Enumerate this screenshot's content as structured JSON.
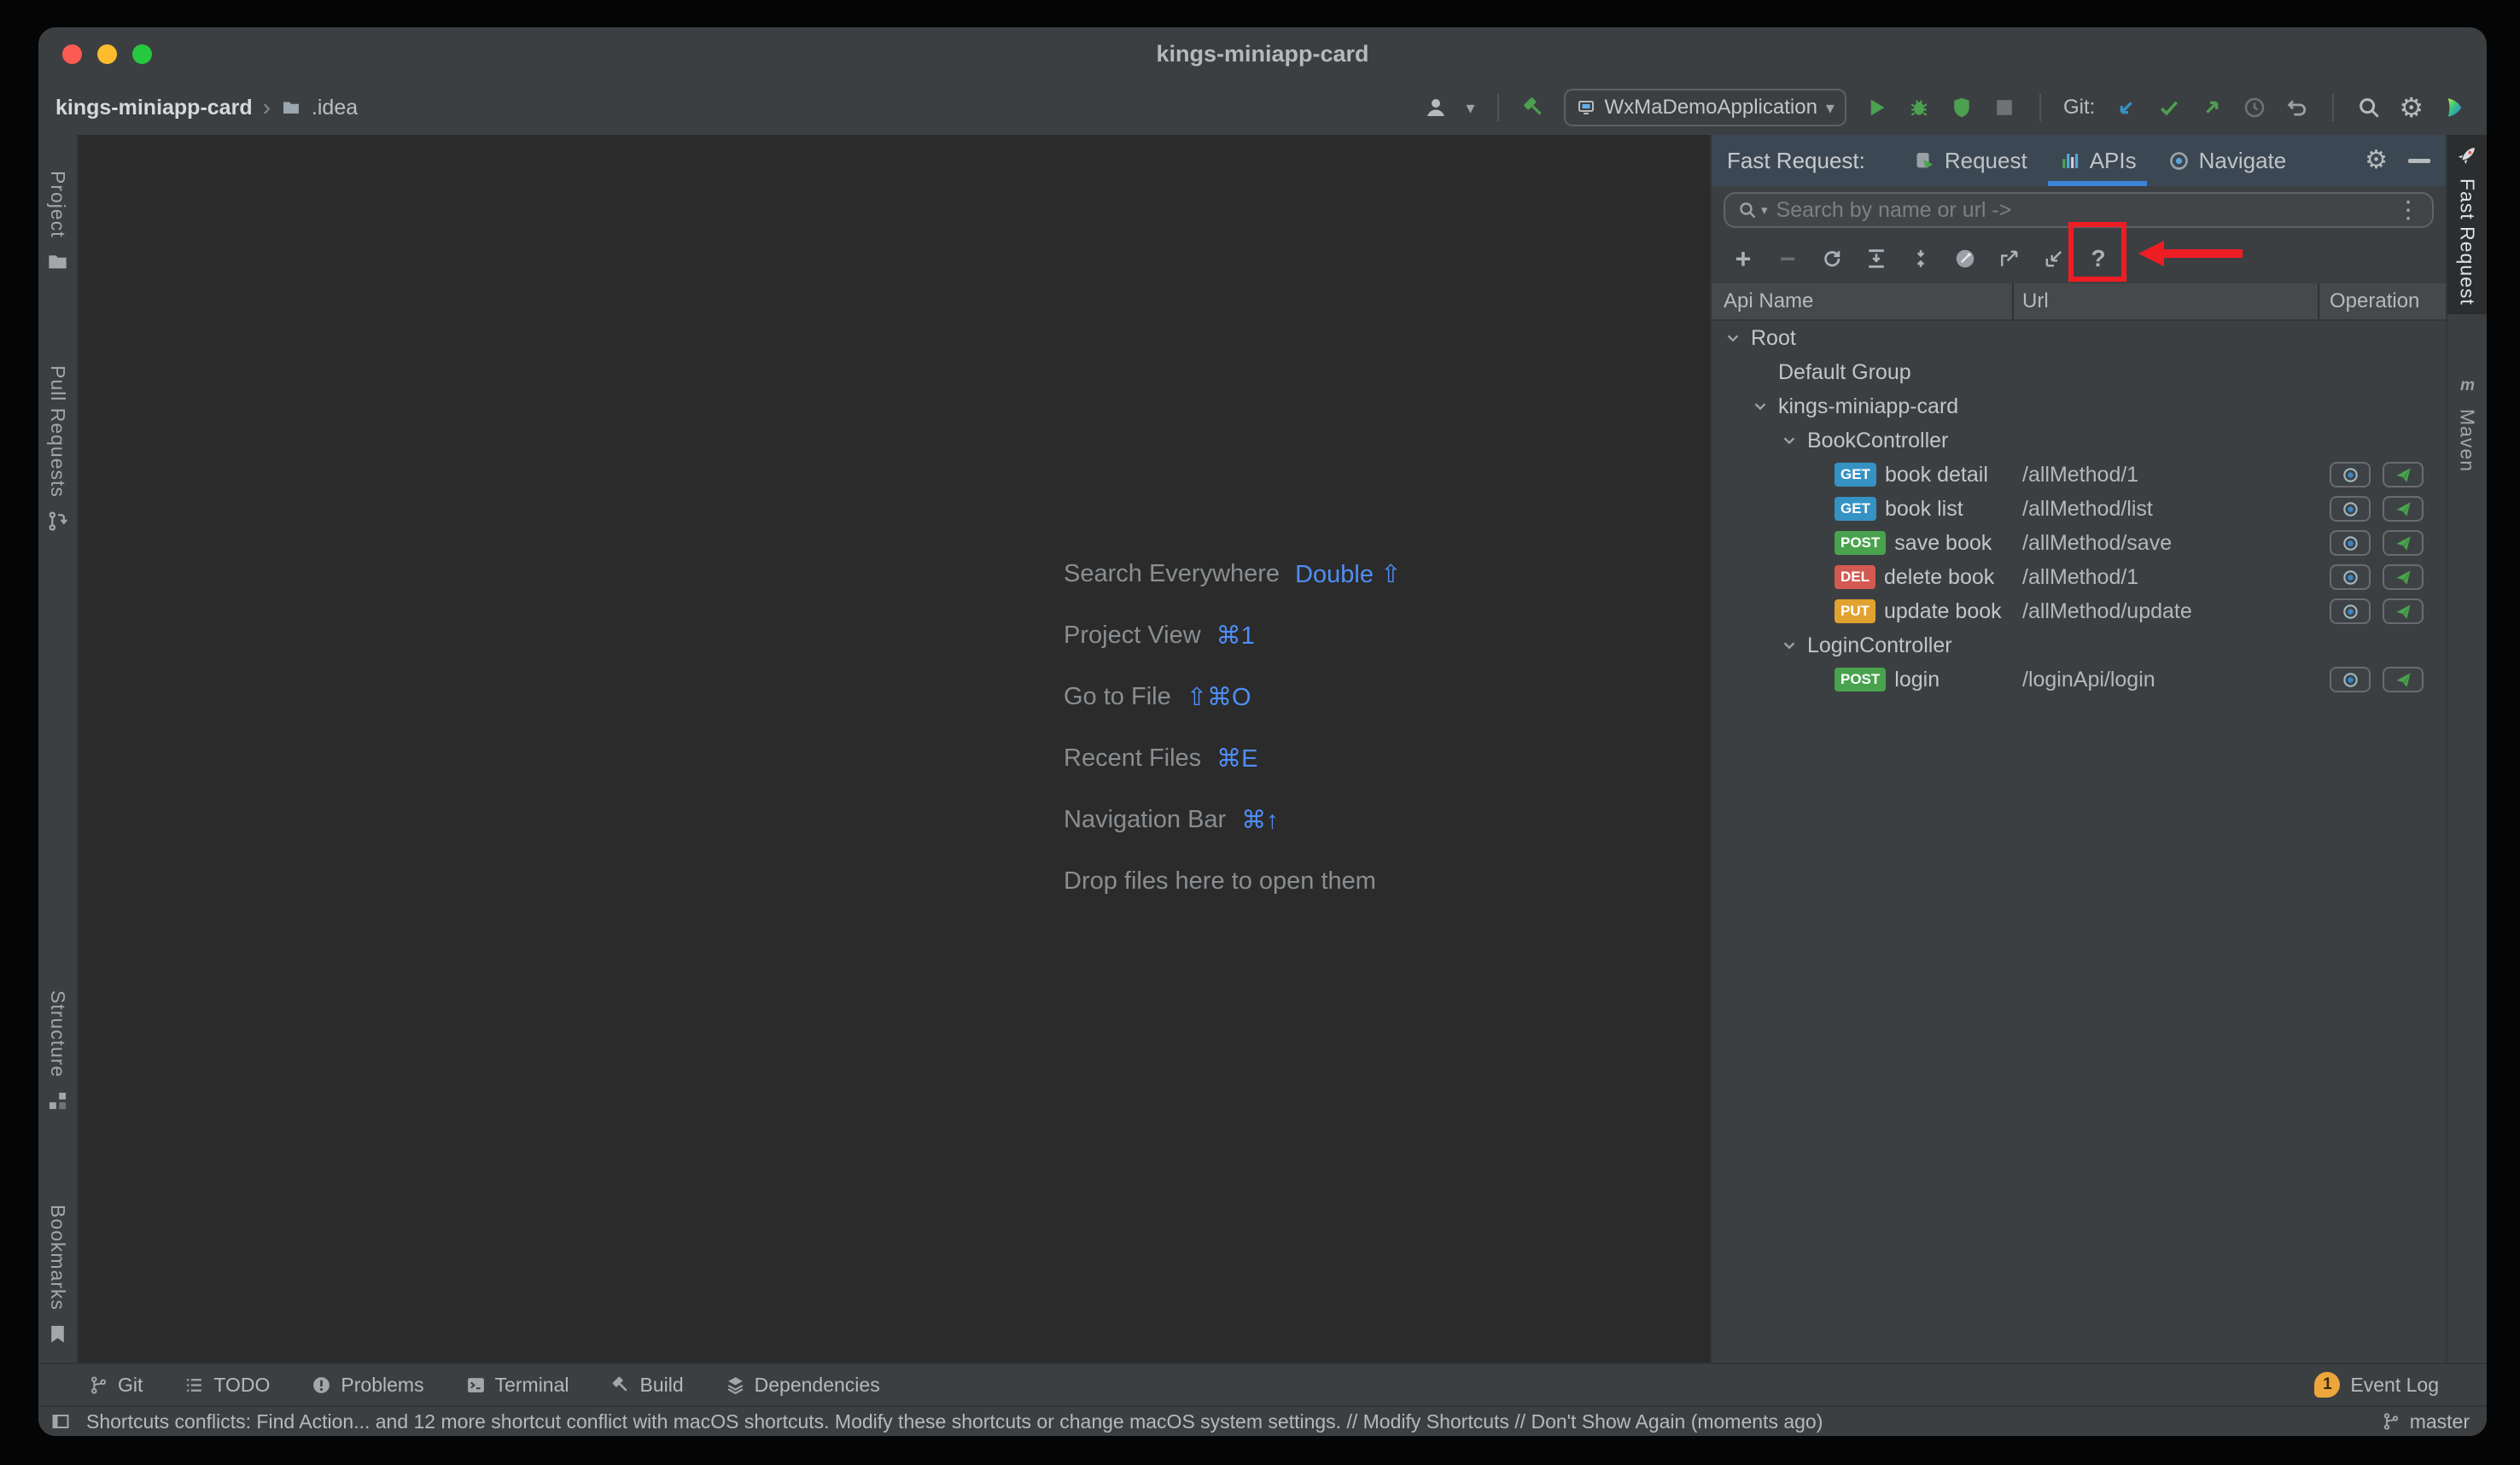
{
  "window": {
    "title": "kings-miniapp-card"
  },
  "breadcrumb": {
    "project": "kings-miniapp-card",
    "separator": "›",
    "folder": ".idea"
  },
  "main_toolbar": {
    "run_config": "WxMaDemoApplication",
    "git_label": "Git:"
  },
  "left_stripe": {
    "top": [
      {
        "label": "Project",
        "icon": "folder-icon"
      },
      {
        "label": "Pull Requests",
        "icon": "pull-request-icon"
      }
    ],
    "bottom": [
      {
        "label": "Structure",
        "icon": "structure-icon"
      },
      {
        "label": "Bookmarks",
        "icon": "bookmark-icon"
      }
    ]
  },
  "right_stripe": [
    {
      "label": "Fast Request",
      "icon": "rocket-icon",
      "active": true
    },
    {
      "label": "Maven",
      "icon": "maven-icon",
      "active": false
    }
  ],
  "editor": {
    "shortcuts": [
      {
        "label": "Search Everywhere",
        "keys": "Double ⇧"
      },
      {
        "label": "Project View",
        "keys": "⌘1"
      },
      {
        "label": "Go to File",
        "keys": "⇧⌘O"
      },
      {
        "label": "Recent Files",
        "keys": "⌘E"
      },
      {
        "label": "Navigation Bar",
        "keys": "⌘↑"
      },
      {
        "label": "Drop files here to open them",
        "keys": ""
      }
    ]
  },
  "fast_request": {
    "title": "Fast Request:",
    "tabs": [
      {
        "label": "Request",
        "icon": "request-tab-icon",
        "selected": false
      },
      {
        "label": "APIs",
        "icon": "apis-tab-icon",
        "selected": true
      },
      {
        "label": "Navigate",
        "icon": "navigate-tab-icon",
        "selected": false
      }
    ],
    "search": {
      "placeholder": "Search by name or url ->"
    },
    "toolbar": [
      {
        "icon": "add-icon",
        "disabled": false,
        "annotated": false
      },
      {
        "icon": "remove-icon",
        "disabled": true,
        "annotated": false
      },
      {
        "icon": "refresh-icon",
        "disabled": false,
        "annotated": false
      },
      {
        "icon": "expand-all-icon",
        "disabled": false,
        "annotated": false
      },
      {
        "icon": "collapse-all-icon",
        "disabled": false,
        "annotated": false
      },
      {
        "icon": "postman-icon",
        "disabled": false,
        "annotated": false
      },
      {
        "icon": "export-icon",
        "disabled": false,
        "annotated": false
      },
      {
        "icon": "import-icon",
        "disabled": false,
        "annotated": false
      },
      {
        "icon": "help-icon",
        "disabled": false,
        "annotated": true
      }
    ],
    "columns": [
      "Api Name",
      "Url",
      "Operation"
    ],
    "tree": [
      {
        "level": 0,
        "type": "group",
        "chevron": true,
        "name": "Root",
        "url": ""
      },
      {
        "level": 1,
        "type": "group",
        "chevron": false,
        "name": "Default Group",
        "url": ""
      },
      {
        "level": 1,
        "type": "group",
        "chevron": true,
        "name": "kings-miniapp-card",
        "url": ""
      },
      {
        "level": 2,
        "type": "group",
        "chevron": true,
        "name": "BookController",
        "url": ""
      },
      {
        "level": 3,
        "type": "api",
        "method": "GET",
        "name": "book detail",
        "url": "/allMethod/1"
      },
      {
        "level": 3,
        "type": "api",
        "method": "GET",
        "name": "book list",
        "url": "/allMethod/list"
      },
      {
        "level": 3,
        "type": "api",
        "method": "POST",
        "name": "save book",
        "url": "/allMethod/save"
      },
      {
        "level": 3,
        "type": "api",
        "method": "DEL",
        "name": "delete book",
        "url": "/allMethod/1"
      },
      {
        "level": 3,
        "type": "api",
        "method": "PUT",
        "name": "update book",
        "url": "/allMethod/update"
      },
      {
        "level": 2,
        "type": "group",
        "chevron": true,
        "name": "LoginController",
        "url": ""
      },
      {
        "level": 3,
        "type": "api",
        "method": "POST",
        "name": "login",
        "url": "/loginApi/login"
      }
    ],
    "method_colors": {
      "GET": "#3592c4",
      "POST": "#49a24d",
      "DEL": "#d35a52",
      "PUT": "#e2a230"
    }
  },
  "bottom_toolbar": {
    "items": [
      {
        "label": "Git",
        "icon": "git-branch-icon"
      },
      {
        "label": "TODO",
        "icon": "todo-list-icon"
      },
      {
        "label": "Problems",
        "icon": "problems-icon"
      },
      {
        "label": "Terminal",
        "icon": "terminal-icon"
      },
      {
        "label": "Build",
        "icon": "build-hammer-icon"
      },
      {
        "label": "Dependencies",
        "icon": "dependencies-icon"
      }
    ],
    "event_log": {
      "label": "Event Log",
      "badge": "1"
    }
  },
  "status_bar": {
    "message": "Shortcuts conflicts: Find Action... and 12 more shortcut conflict with macOS shortcuts. Modify these shortcuts or change macOS system settings. // Modify Shortcuts // Don't Show Again (moments ago)",
    "branch": "master"
  },
  "annotation": {
    "color": "#ee1d24",
    "target": "help-icon"
  }
}
